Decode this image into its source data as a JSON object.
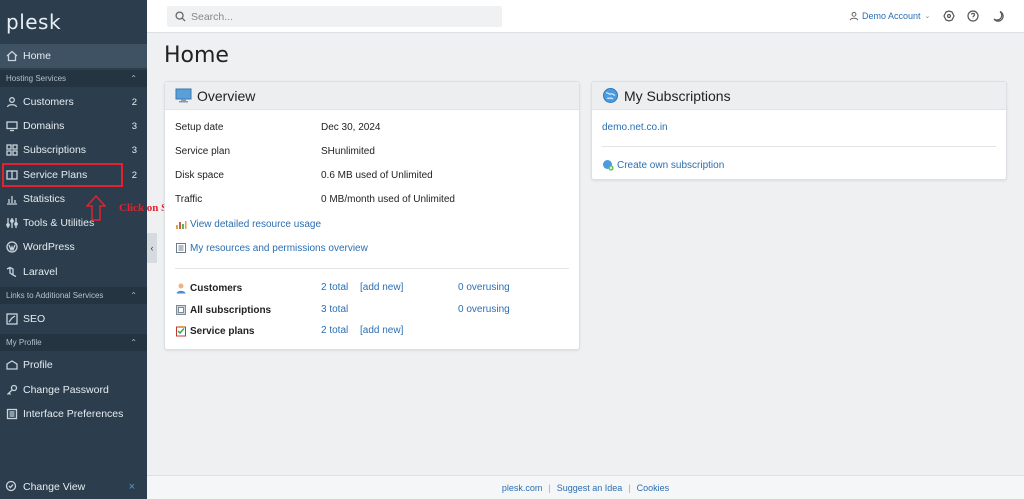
{
  "brand": {
    "logo_text": "plesk"
  },
  "sidebar": {
    "home": "Home",
    "hosting_header": "Hosting Services",
    "hosting_items": [
      {
        "label": "Customers",
        "count": "2",
        "icon": "user-icon"
      },
      {
        "label": "Domains",
        "count": "3",
        "icon": "monitor-icon"
      },
      {
        "label": "Subscriptions",
        "count": "3",
        "icon": "grid-icon"
      },
      {
        "label": "Service Plans",
        "count": "2",
        "icon": "book-icon"
      },
      {
        "label": "Statistics",
        "count": "",
        "icon": "bar-chart-icon"
      },
      {
        "label": "Tools & Utilities",
        "count": "",
        "icon": "tools-icon"
      },
      {
        "label": "WordPress",
        "count": "",
        "icon": "wordpress-icon"
      },
      {
        "label": "Laravel",
        "count": "",
        "icon": "laravel-icon"
      }
    ],
    "additional_header": "Links to Additional Services",
    "seo": "SEO",
    "profile_header": "My Profile",
    "profile_items": [
      {
        "label": "Profile",
        "icon": "profile-icon"
      },
      {
        "label": "Change Password",
        "icon": "key-icon"
      },
      {
        "label": "Interface Preferences",
        "icon": "preferences-icon"
      }
    ],
    "change_view": "Change View"
  },
  "annotation": {
    "text": "Click on Service Plans",
    "color": "#e0232e"
  },
  "topbar": {
    "search_placeholder": "Search...",
    "account_label": "Demo Account"
  },
  "main": {
    "title": "Home",
    "overview": {
      "header": "Overview",
      "rows": [
        {
          "label": "Setup date",
          "value": "Dec 30, 2024"
        },
        {
          "label": "Service plan",
          "value": "SHunlimited"
        },
        {
          "label": "Disk space",
          "value": "0.6 MB used of Unlimited"
        },
        {
          "label": "Traffic",
          "value": "0 MB/month used of Unlimited"
        }
      ],
      "link_usage": "View detailed resource usage",
      "link_resources": "My resources and permissions overview",
      "summary": [
        {
          "label": "Customers",
          "total": "2 total",
          "add": "[add new]",
          "overusing": "0 overusing"
        },
        {
          "label": "All subscriptions",
          "total": "3 total",
          "add": "",
          "overusing": "0 overusing"
        },
        {
          "label": "Service plans",
          "total": "2 total",
          "add": "[add new]",
          "overusing": ""
        }
      ]
    },
    "subscriptions": {
      "header": "My Subscriptions",
      "domain": "demo.net.co.in",
      "create_link": "Create own subscription"
    }
  },
  "footer": {
    "links": [
      "plesk.com",
      "Suggest an Idea",
      "Cookies"
    ]
  },
  "colors": {
    "sidebar_bg": "#2c3e4d",
    "link": "#2a6fb3",
    "accent_red": "#e0232e"
  }
}
